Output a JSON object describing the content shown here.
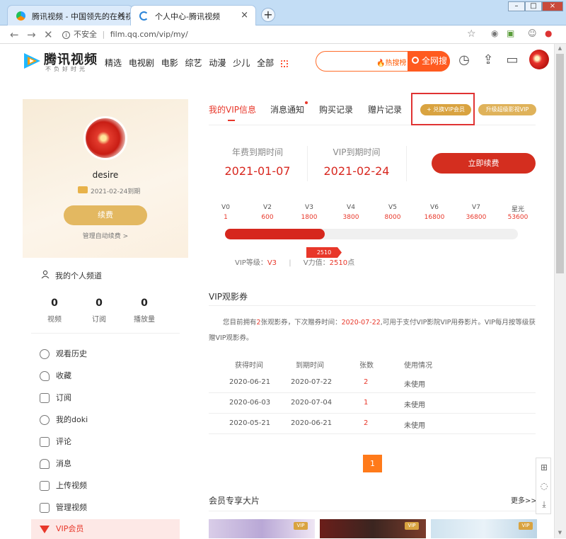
{
  "browser": {
    "tabs": [
      {
        "title": "腾讯视频 - 中国领先的在线视频...",
        "active": false
      },
      {
        "title": "个人中心-腾讯视频",
        "active": true
      }
    ],
    "newtab_symbol": "+",
    "window_controls": [
      "–",
      "□",
      "×"
    ],
    "address": {
      "security": "不安全",
      "url": "film.qq.com/vip/my/"
    }
  },
  "site": {
    "logo_text": "腾讯视频",
    "logo_slogan": "不负好时光",
    "nav": [
      "精选",
      "电视剧",
      "电影",
      "综艺",
      "动漫",
      "少儿",
      "全部"
    ],
    "search": {
      "hot_label": "热搜榜",
      "button_label": "全网搜"
    }
  },
  "sidebar": {
    "username": "desire",
    "vip_expire_note": "2021-02-24到期",
    "renew_button": "续费",
    "autorenew_link": "管理自动续费 >",
    "channel_link": "我的个人频道",
    "stats": [
      {
        "value": "0",
        "label": "视频"
      },
      {
        "value": "0",
        "label": "订阅"
      },
      {
        "value": "0",
        "label": "播放量"
      }
    ],
    "menu": [
      {
        "label": "观看历史",
        "icon": "clock-icon"
      },
      {
        "label": "收藏",
        "icon": "heart-icon"
      },
      {
        "label": "订阅",
        "icon": "bookmark-icon"
      },
      {
        "label": "我的doki",
        "icon": "doki-icon"
      },
      {
        "label": "评论",
        "icon": "comment-icon"
      },
      {
        "label": "消息",
        "icon": "bell-icon"
      },
      {
        "label": "上传视频",
        "icon": "upload-icon"
      },
      {
        "label": "管理视频",
        "icon": "video-manage-icon"
      },
      {
        "label": "VIP会员",
        "icon": "vip-icon",
        "active": true
      }
    ]
  },
  "content": {
    "tabs": [
      "我的VIP信息",
      "消息通知",
      "购买记录",
      "赠片记录"
    ],
    "redeem_button": "+ 兑换VIP会员",
    "upgrade_button": "升级超级影视VIP",
    "annual_label": "年费到期时间",
    "annual_date": "2021-01-07",
    "vip_label": "VIP到期时间",
    "vip_date": "2021-02-24",
    "renew_now_button": "立即续费",
    "levels": [
      {
        "name": "V0",
        "points": "1"
      },
      {
        "name": "V2",
        "points": "600"
      },
      {
        "name": "V3",
        "points": "1800"
      },
      {
        "name": "V4",
        "points": "3800"
      },
      {
        "name": "V5",
        "points": "8000"
      },
      {
        "name": "V6",
        "points": "16800"
      },
      {
        "name": "V7",
        "points": "36800"
      },
      {
        "name": "星光",
        "points": "53600"
      }
    ],
    "progress_fraction": 0.34,
    "progress_value": "2510",
    "vip_level_label": "VIP等级：",
    "vip_level_value": "V3",
    "separator": "|",
    "vip_power_label": "V力值：",
    "vip_power_value": "2510",
    "vip_power_unit": "点",
    "coupons": {
      "title": "VIP观影券",
      "desc_prefix": "您目前拥有",
      "desc_count": "2",
      "desc_mid": "张观影券，下次赠券时间：",
      "desc_date": "2020-07-22",
      "desc_suffix": ",可用于支付VIP影院VIP用券影片。VIP每月按等级获赠VIP观影券。",
      "headers": [
        "获得时间",
        "到期时间",
        "张数",
        "使用情况"
      ],
      "rows": [
        {
          "got": "2020-06-21",
          "expire": "2020-07-22",
          "count": "2",
          "status": "未使用"
        },
        {
          "got": "2020-06-03",
          "expire": "2020-07-04",
          "count": "1",
          "status": "未使用"
        },
        {
          "got": "2020-05-21",
          "expire": "2020-06-21",
          "count": "2",
          "status": "未使用"
        }
      ],
      "page": "1"
    },
    "member_section": {
      "title": "会员专享大片",
      "more": "更多>>",
      "badge": "VIP"
    }
  },
  "colors": {
    "brand_red": "#e8372a",
    "gold": "#d9a340",
    "orange": "#ff5a1f"
  }
}
